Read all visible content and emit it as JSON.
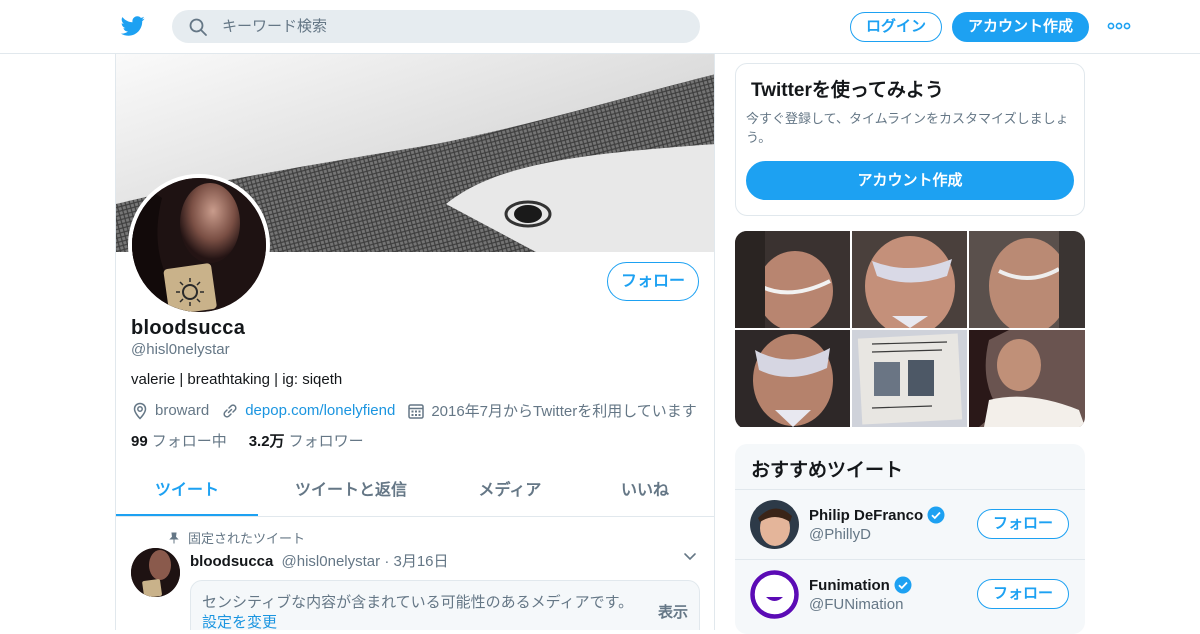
{
  "header": {
    "search_placeholder": "キーワード検索",
    "login_label": "ログイン",
    "signup_label": "アカウント作成",
    "accent_color": "#1da1f2"
  },
  "profile": {
    "follow_label": "フォロー",
    "name": "bloodsucca",
    "handle": "@hisl0nelystar",
    "bio": "valerie | breathtaking | ig: siqeth",
    "location": "broward",
    "link": "depop.com/lonelyfiend",
    "joined": "2016年7月からTwitterを利用しています",
    "following_count": "99",
    "following_label": "フォロー中",
    "followers_count": "3.2万",
    "followers_label": "フォロワー"
  },
  "tabs": [
    {
      "label": "ツイート",
      "active": true
    },
    {
      "label": "ツイートと返信",
      "active": false
    },
    {
      "label": "メディア",
      "active": false
    },
    {
      "label": "いいね",
      "active": false
    }
  ],
  "pinned_tweet": {
    "pinned_label": "固定されたツイート",
    "name": "bloodsucca",
    "handle": "@hisl0nelystar",
    "separator": "·",
    "date": "3月16日",
    "sensitive_message": "センシティブな内容が含まれている可能性のあるメディアです。",
    "settings_link": "設定を変更",
    "show_label": "表示"
  },
  "signup_card": {
    "title": "Twitterを使ってみよう",
    "description": "今すぐ登録して、タイムラインをカスタマイズしましょう。",
    "button_label": "アカウント作成"
  },
  "recommended": {
    "title": "おすすめツイート",
    "accounts": [
      {
        "name": "Philip DeFranco",
        "handle": "@PhillyD",
        "verified": true,
        "follow_label": "フォロー"
      },
      {
        "name": "Funimation",
        "handle": "@FUNimation",
        "verified": true,
        "follow_label": "フォロー"
      }
    ]
  }
}
